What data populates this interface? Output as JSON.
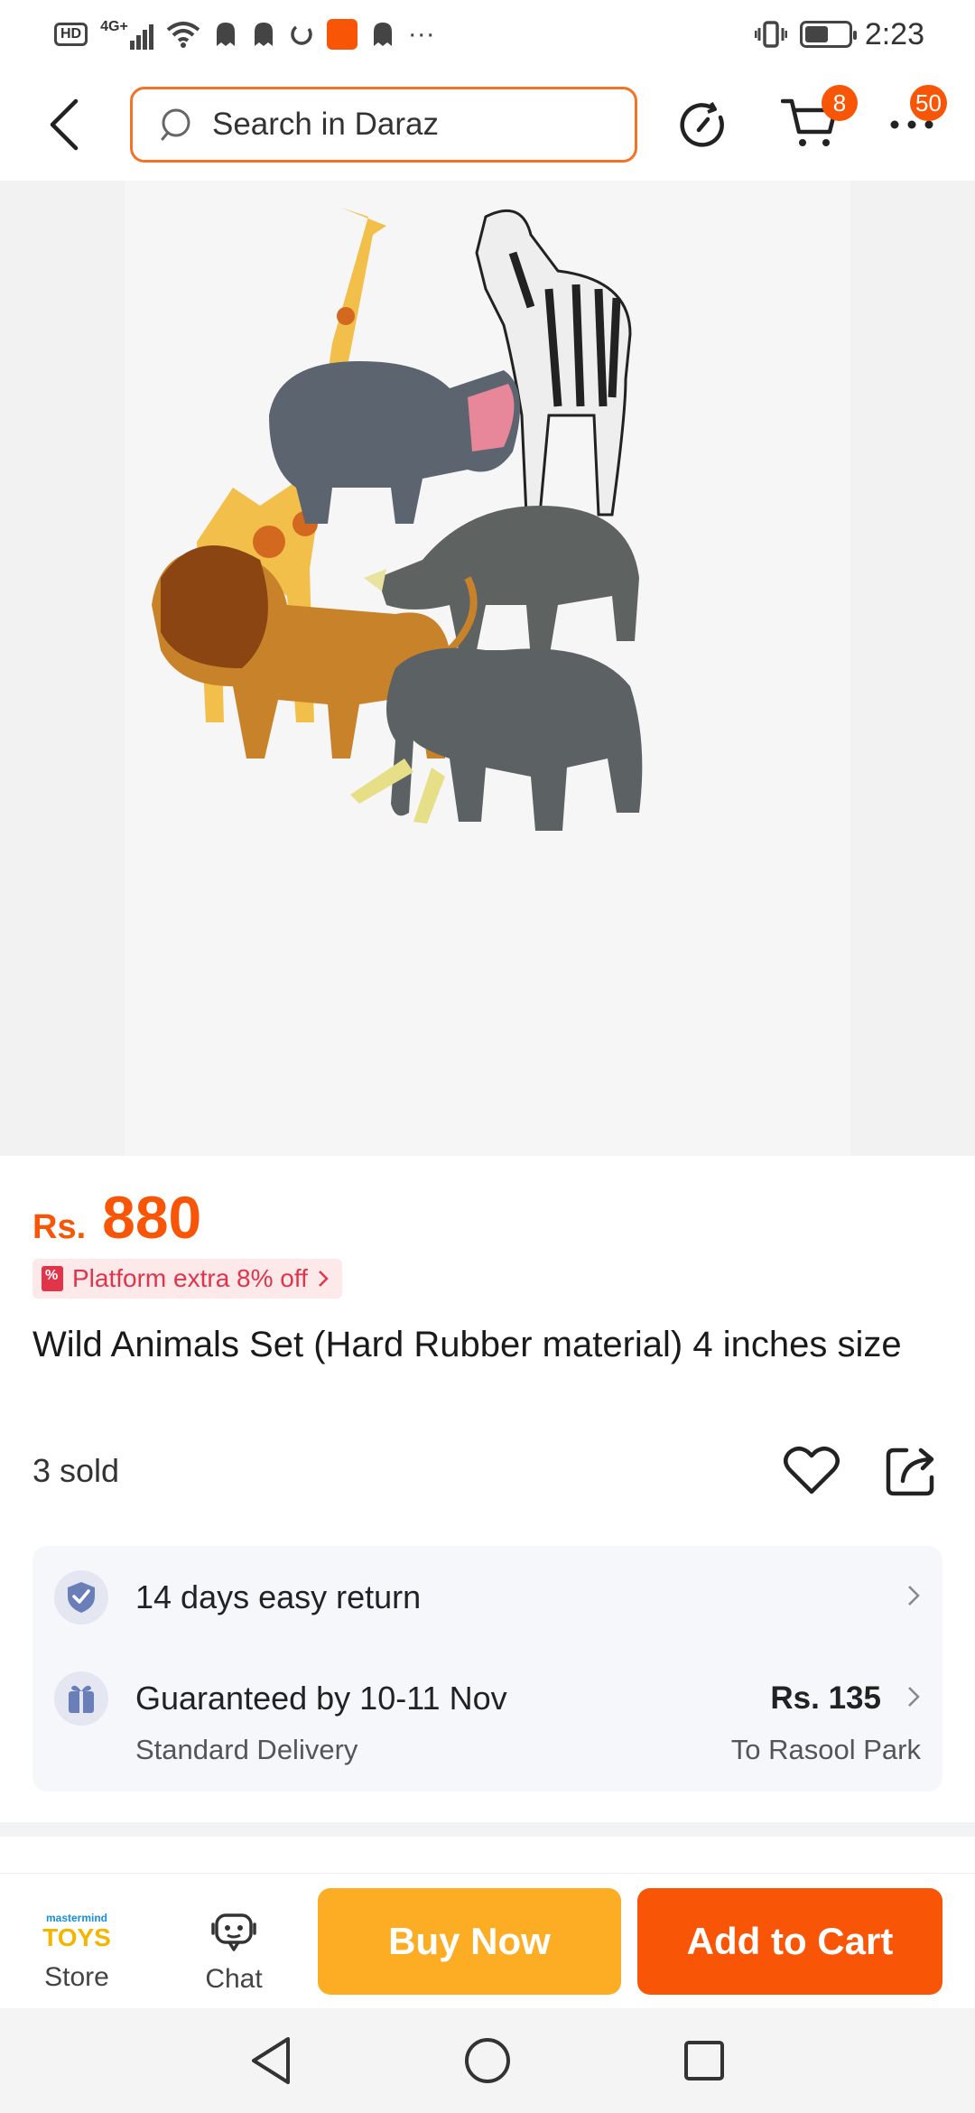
{
  "status_bar": {
    "time": "2:23",
    "network": "4G+",
    "hd": "HD",
    "more": "···"
  },
  "top_nav": {
    "search_placeholder": "Search in Daraz",
    "cart_count": "8",
    "more_count": "50",
    "accent_color": "#f57224"
  },
  "product": {
    "image_icons": [
      "giraffe",
      "zebra",
      "hippo",
      "rhino",
      "lion",
      "elephant"
    ],
    "currency": "Rs.",
    "price": "880",
    "promo": "Platform extra 8% off",
    "title": "Wild Animals Set (Hard Rubber material) 4 inches size",
    "sold": "3 sold"
  },
  "services": {
    "return_text": "14 days easy return",
    "delivery_title": "Guaranteed by 10-11 Nov",
    "delivery_type": "Standard Delivery",
    "delivery_price": "Rs. 135",
    "delivery_location": "To Rasool Park"
  },
  "action_bar": {
    "store_label": "Store",
    "store_logo_top": "mastermind",
    "store_logo_main": "TOYS",
    "chat_label": "Chat",
    "buy_now": "Buy Now",
    "add_to_cart": "Add to Cart",
    "buy_color": "#fcad24",
    "cart_color": "#f85606"
  }
}
